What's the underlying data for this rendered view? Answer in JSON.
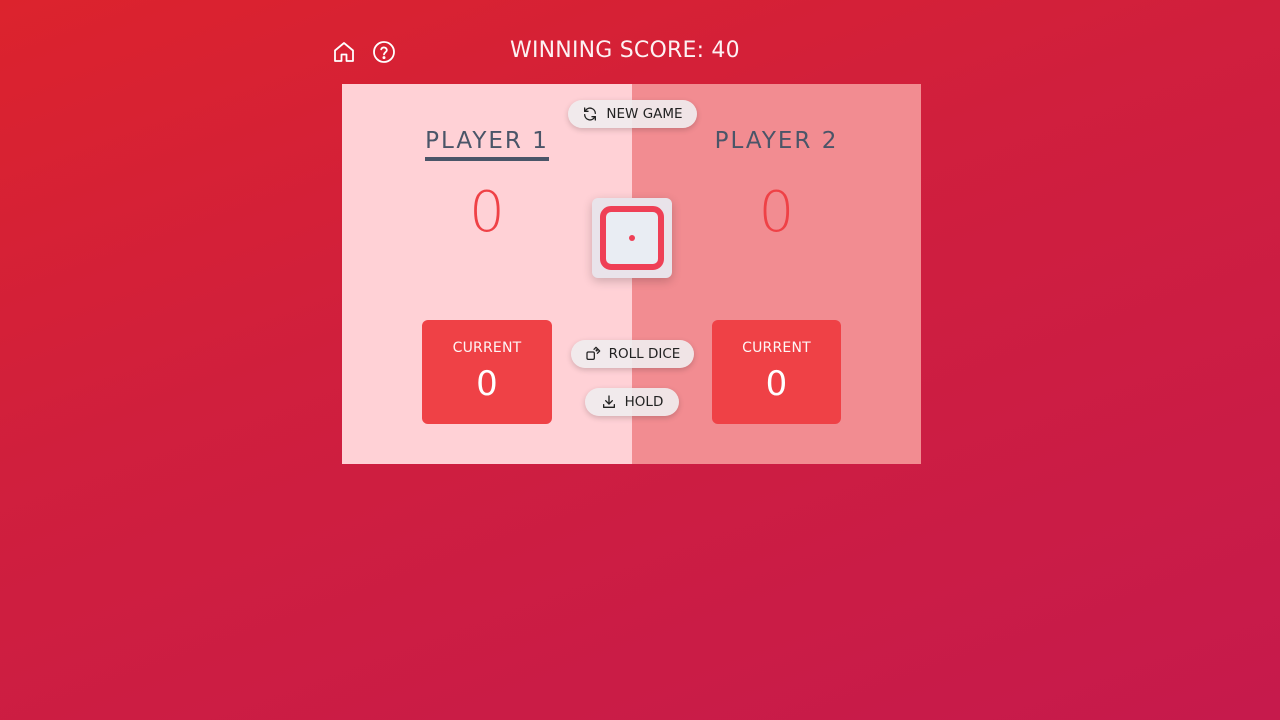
{
  "header": {
    "home_icon": "home-icon",
    "help_icon": "help-circle-icon",
    "winning_score_label": "WINNING SCORE: 40"
  },
  "controls": {
    "new_game_label": "NEW GAME",
    "roll_dice_label": "ROLL DICE",
    "hold_label": "HOLD"
  },
  "players": [
    {
      "name": "PLAYER 1",
      "score": "0",
      "current_label": "CURRENT",
      "current_value": "0",
      "active": true
    },
    {
      "name": "PLAYER 2",
      "score": "0",
      "current_label": "CURRENT",
      "current_value": "0",
      "active": false
    }
  ],
  "dice": {
    "value": 1
  },
  "colors": {
    "background_start": "#dc232d",
    "background_end": "#c61a4c",
    "player1_panel": "#ffd1d6",
    "player2_panel": "#f28c91",
    "accent": "#ef4146",
    "name_text": "#4a5568"
  }
}
